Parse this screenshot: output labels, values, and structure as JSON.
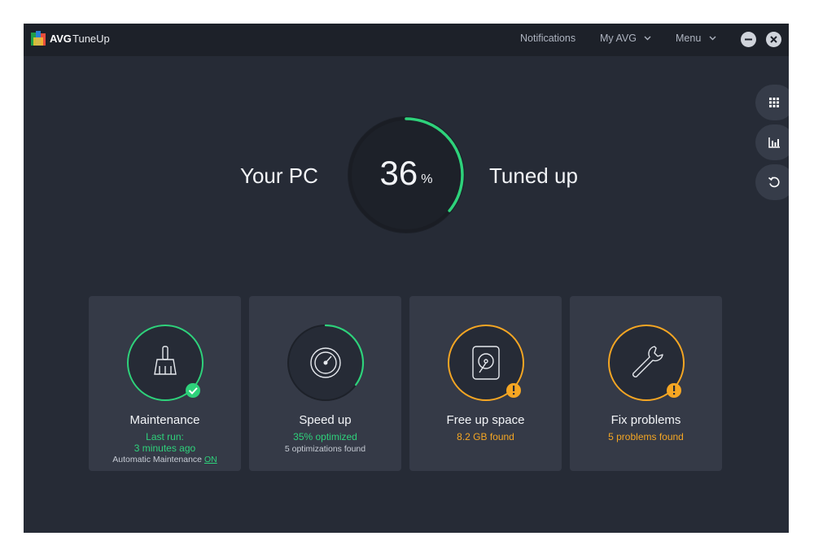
{
  "titlebar": {
    "brand": "AVG",
    "app_name": "TuneUp",
    "nav": {
      "notifications": "Notifications",
      "my_avg": "My AVG",
      "menu": "Menu"
    }
  },
  "hero": {
    "left_label": "Your PC",
    "right_label": "Tuned up",
    "value": "36",
    "unit": "%",
    "progress_fraction": 0.36,
    "ring_color": "#2ed27b"
  },
  "side_buttons": [
    "apps-grid-icon",
    "bar-chart-icon",
    "undo-icon"
  ],
  "cards": [
    {
      "title": "Maintenance",
      "line1": "Last run:",
      "line2": "3 minutes ago",
      "line3_prefix": "Automatic Maintenance",
      "line3_link": "ON",
      "status": "ok"
    },
    {
      "title": "Speed up",
      "line1": "35% optimized",
      "line2": "5 optimizations found",
      "progress_fraction": 0.35
    },
    {
      "title": "Free up space",
      "line1": "8.2 GB found",
      "status": "warning"
    },
    {
      "title": "Fix problems",
      "line1": "5 problems found",
      "status": "warning"
    }
  ],
  "colors": {
    "accent_green": "#2ed27b",
    "warning_orange": "#f5a623",
    "background": "#262b36",
    "card": "#353a47"
  }
}
